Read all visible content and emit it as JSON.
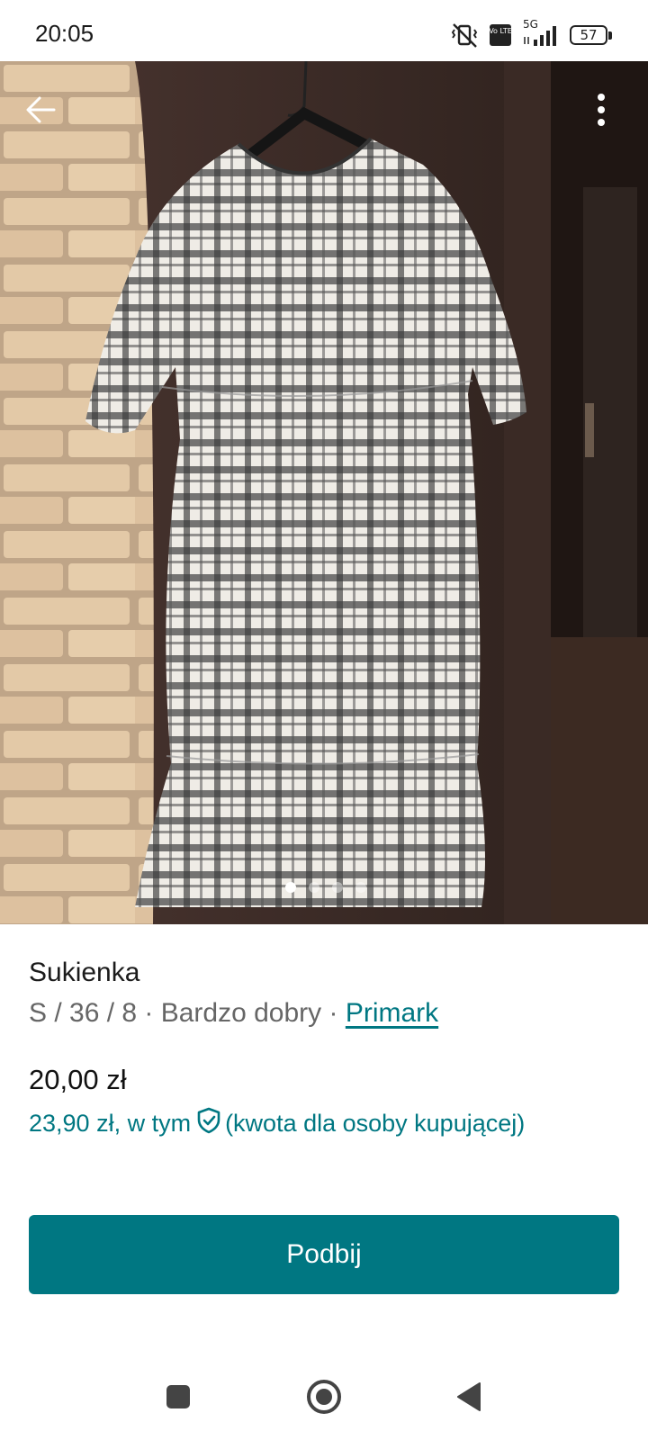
{
  "status_bar": {
    "time": "20:05",
    "network_label": "5G",
    "volte_label": "Vo LTE",
    "battery_level": "57",
    "icons": [
      "vibrate-off-icon",
      "volte-icon",
      "signal-icon",
      "battery-icon"
    ]
  },
  "photo": {
    "image_count": 4,
    "active_index": 0,
    "back_icon": "arrow-left-icon",
    "more_icon": "more-vertical-icon"
  },
  "item": {
    "title": "Sukienka",
    "meta_prefix": "S / 36 / 8 · Bardzo dobry · ",
    "brand": "Primark",
    "price": "20,00 zł",
    "buyer_price_prefix": "23,90 zł, w tym",
    "buyer_price_suffix": "(kwota dla osoby kupującej)"
  },
  "actions": {
    "bump_label": "Podbij"
  },
  "nav": {
    "icons": [
      "square-recents-icon",
      "circle-home-icon",
      "triangle-back-icon"
    ]
  },
  "colors": {
    "accent": "#007782",
    "text_primary": "#111111",
    "text_secondary": "#666666"
  }
}
